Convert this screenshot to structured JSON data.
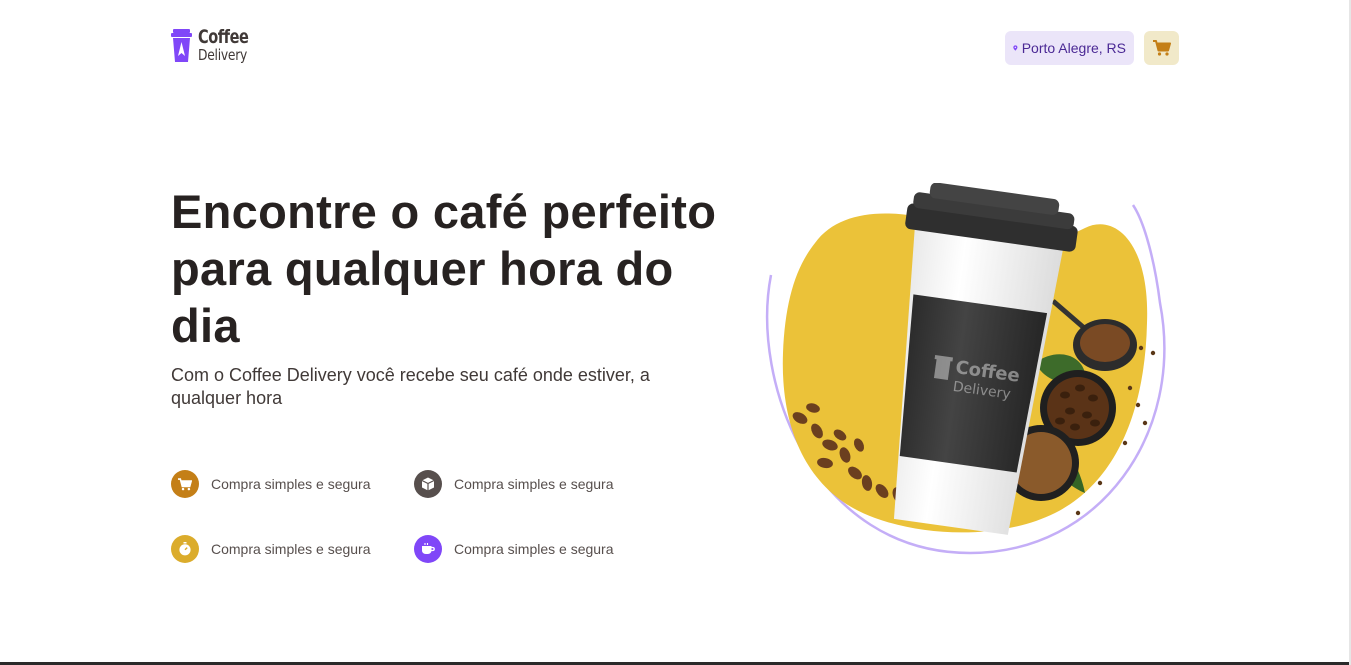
{
  "header": {
    "logo": {
      "line1": "Coffee",
      "line2": "Delivery"
    },
    "location": {
      "label": "Porto Alegre, RS",
      "icon": "map-pin-icon"
    },
    "cart": {
      "icon": "shopping-cart-icon"
    }
  },
  "hero": {
    "title": "Encontre o café perfeito para qualquer hora do dia",
    "subtitle": "Com o Coffee Delivery você recebe seu café onde estiver, a qualquer hora",
    "image_brand": {
      "line1": "Coffee",
      "line2": "Delivery"
    }
  },
  "features": [
    {
      "label": "Compra simples e segura",
      "icon": "shopping-cart-icon",
      "color": "#C47F17"
    },
    {
      "label": "Compra simples e segura",
      "icon": "package-icon",
      "color": "#574F4D"
    },
    {
      "label": "Compra simples e segura",
      "icon": "timer-icon",
      "color": "#DBAC2C"
    },
    {
      "label": "Compra simples e segura",
      "icon": "coffee-icon",
      "color": "#8047F8"
    }
  ],
  "colors": {
    "brand_purple": "#8047F8",
    "purple_light": "#EBE5F9",
    "yellow": "#DBAC2C",
    "yellow_dark": "#C47F17",
    "yellow_light": "#F1E9C9",
    "title": "#272221"
  }
}
